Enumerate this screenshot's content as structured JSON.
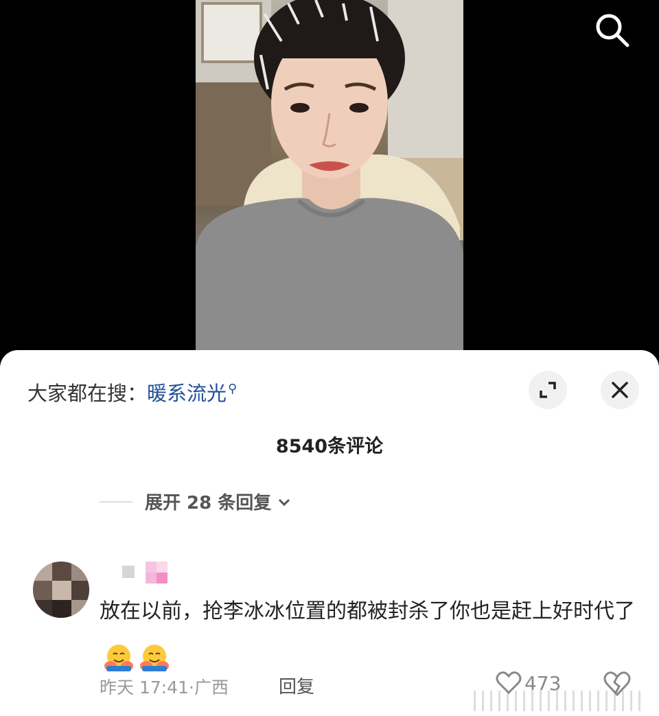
{
  "hot_search": {
    "prefix": "大家都在搜：",
    "keyword": "暖系流光"
  },
  "comments_header": {
    "count_label": "8540条评论"
  },
  "replies_toggle": {
    "label": "展开 28 条回复"
  },
  "comment": {
    "text": "放在以前，抢李冰冰位置的都被封杀了你也是赶上好时代了",
    "emoji": [
      "hugging-face",
      "hugging-face"
    ],
    "time": "昨天 17:41",
    "location": "广西",
    "reply_label": "回复",
    "like_count": "473"
  },
  "colors": {
    "link_blue": "#1f4f96",
    "sheet_bg": "#ffffff",
    "muted_text": "#999999"
  }
}
